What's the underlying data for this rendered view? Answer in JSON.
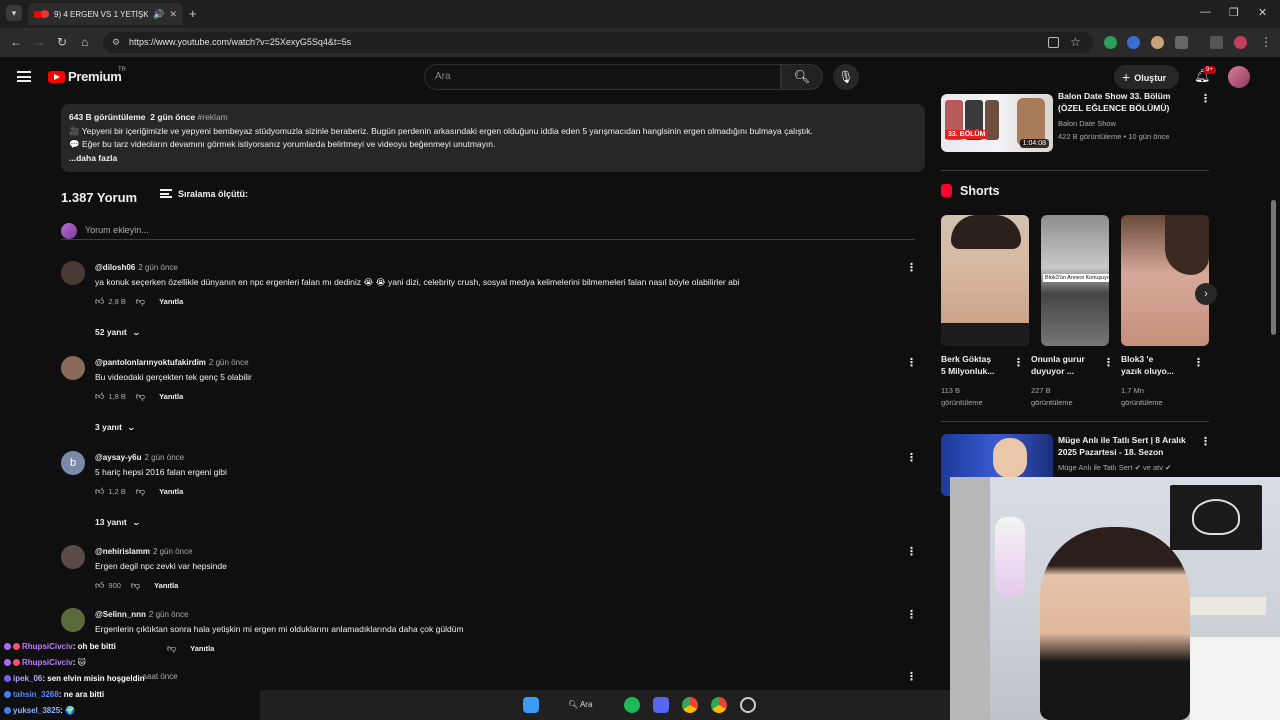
{
  "browser": {
    "tab_title": "9) 4 ERGEN VS 1 YETİŞKİN",
    "url": "https://www.youtube.com/watch?v=25XexyG5Sq4&t=5s"
  },
  "youtube": {
    "logo_text": "Premium",
    "country": "TR",
    "search_placeholder": "Ara",
    "create_label": "Oluştur",
    "notif_count": "9+"
  },
  "description": {
    "views": "643 B görüntüleme",
    "date": "2 gün önce",
    "hashtag": "#reklam",
    "line1": "🎥 Yepyeni bir içeriğimizle ve yepyeni bembeyaz stüdyomuzla sizinle beraberiz. Bugün perdenin arkasındaki ergen olduğunu iddia eden 5 yarışmacıdan hangisinin ergen olmadığını bulmaya çalıştık.",
    "line2": "💬 Eğer bu tarz videoların devamını görmek istiyorsanız yorumlarda belirtmeyi ve videoyu beğenmeyi unutmayın.",
    "more": "...daha fazla"
  },
  "comments_header": {
    "count": "1.387 Yorum",
    "sort_label": "Sıralama ölçütü:",
    "add_placeholder": "Yorum ekleyin..."
  },
  "comments": [
    {
      "author": "@dilosh06",
      "time": "2 gün önce",
      "text": "ya konuk seçerken özellikle dünyanın en npc ergenleri falan mı dediniz 😭 😭  yani dizi, celebrity crush, sosyal medya kelimelerini bilmemeleri falan nasıl böyle olabilirler abi",
      "likes": "2,8 B",
      "reply": "Yanıtla",
      "replies": "52 yanıt",
      "avatar_color": "#4a3a34"
    },
    {
      "author": "@pantolonlarınyoktufakirdim",
      "time": "2 gün önce",
      "text": "Bu videodaki gerçekten tek genç 5 olabilir",
      "likes": "1,8 B",
      "reply": "Yanıtla",
      "replies": "3 yanıt",
      "avatar_color": "#8a6a5a"
    },
    {
      "author": "@aysay-y6u",
      "time": "2 gün önce",
      "text": "5 hariç hepsi 2016 falan ergeni gibi",
      "likes": "1,2 B",
      "reply": "Yanıtla",
      "replies": "13 yanıt",
      "avatar_color": "#7b8aa8",
      "avatar_letter": "b"
    },
    {
      "author": "@nehirislamm",
      "time": "2 gün önce",
      "text": "Ergen degil npc zevki var hepsinde",
      "likes": "900",
      "reply": "Yanıtla",
      "avatar_color": "#5a4a4a"
    },
    {
      "author": "@Selinn_nnn",
      "time": "2 gün önce",
      "text": "Ergenlerin çıktıktan sonra hala yetişkin mi ergen mi olduklarını anlamadıklarında daha çok güldüm",
      "likes": "",
      "reply": "Yanıtla",
      "avatar_color": "#5a6a3a"
    }
  ],
  "partial_comment_time": "saat önce",
  "sidebar": {
    "top_video": {
      "title_line1": "Balon Date Show 33. Bölüm",
      "title_line2": "(ÖZEL EĞLENCE BÖLÜMÜ)",
      "channel": "Balon Date Show",
      "meta": "422 B görüntüleme • 10 gün önce",
      "duration": "1:04:08",
      "thumb_label": "33. BÖLÜM"
    },
    "shorts_label": "Shorts",
    "shorts": [
      {
        "title1": "Berk Göktaş",
        "title2": "5 Milyonluk...",
        "views1": "113 B",
        "views2": "görüntüleme"
      },
      {
        "title1": "Onunla gurur",
        "title2": "duyuyor ...",
        "views1": "227 B",
        "views2": "görüntüleme",
        "caption": "Blok3'ün Annesi Konuşuyor"
      },
      {
        "title1": "Blok3 'e",
        "title2": "yazık oluyo...",
        "views1": "1,7 Mn",
        "views2": "görüntüleme"
      }
    ],
    "video2": {
      "title_line1": "Müge Anlı ile Tatlı Sert | 8 Aralık",
      "title_line2": "2025 Pazartesi - 18. Sezon",
      "channel": "Müge Anlı ile Tatlı Sert",
      "channel_extra": "ve atv"
    }
  },
  "chat": [
    {
      "user": "RhupsiCivciv",
      "msg": ": oh be bitti",
      "color": "#c37bff"
    },
    {
      "user": "RhupsiCivciv",
      "msg": ": ",
      "color": "#c37bff"
    },
    {
      "user": "ipek_06",
      "msg": ": sen elvin misin hoşgeldin",
      "color": "#b9a6ff"
    },
    {
      "user": "tahsin_3268",
      "msg": ": ne ara bitti",
      "color": "#4f8cff"
    },
    {
      "user": "yuksel_3825",
      "msg": ": ",
      "color": "#8fb3ff"
    }
  ],
  "taskbar": {
    "search_label": "Ara"
  },
  "icons": [
    "search-icon",
    "mic-icon",
    "bell-icon",
    "like-icon",
    "dislike-icon",
    "more-icon",
    "chevron-down-icon",
    "sort-icon",
    "shorts-icon",
    "windows-start-icon",
    "spotify-icon",
    "discord-icon",
    "chrome-icon"
  ]
}
